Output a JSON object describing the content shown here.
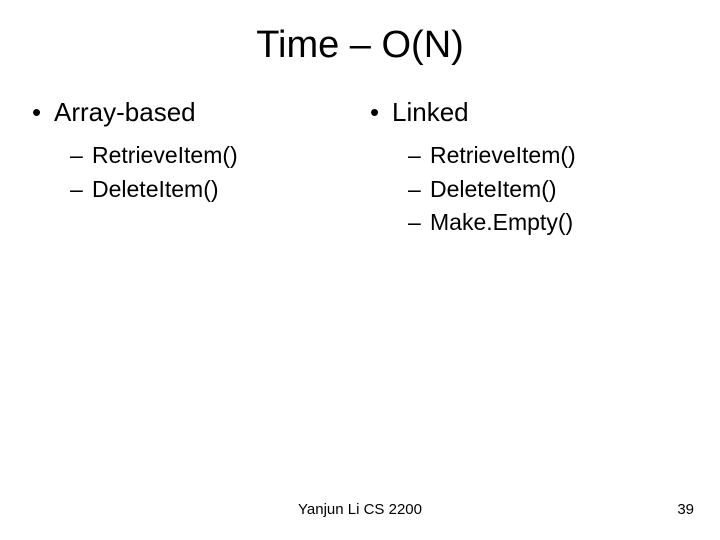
{
  "title": "Time – O(N)",
  "columns": {
    "left": {
      "heading": "Array-based",
      "items": [
        "RetrieveItem()",
        "DeleteItem()"
      ]
    },
    "right": {
      "heading": "Linked",
      "items": [
        "RetrieveItem()",
        "DeleteItem()",
        "Make.Empty()"
      ]
    }
  },
  "footer": {
    "center": "Yanjun Li CS 2200",
    "page": "39"
  }
}
